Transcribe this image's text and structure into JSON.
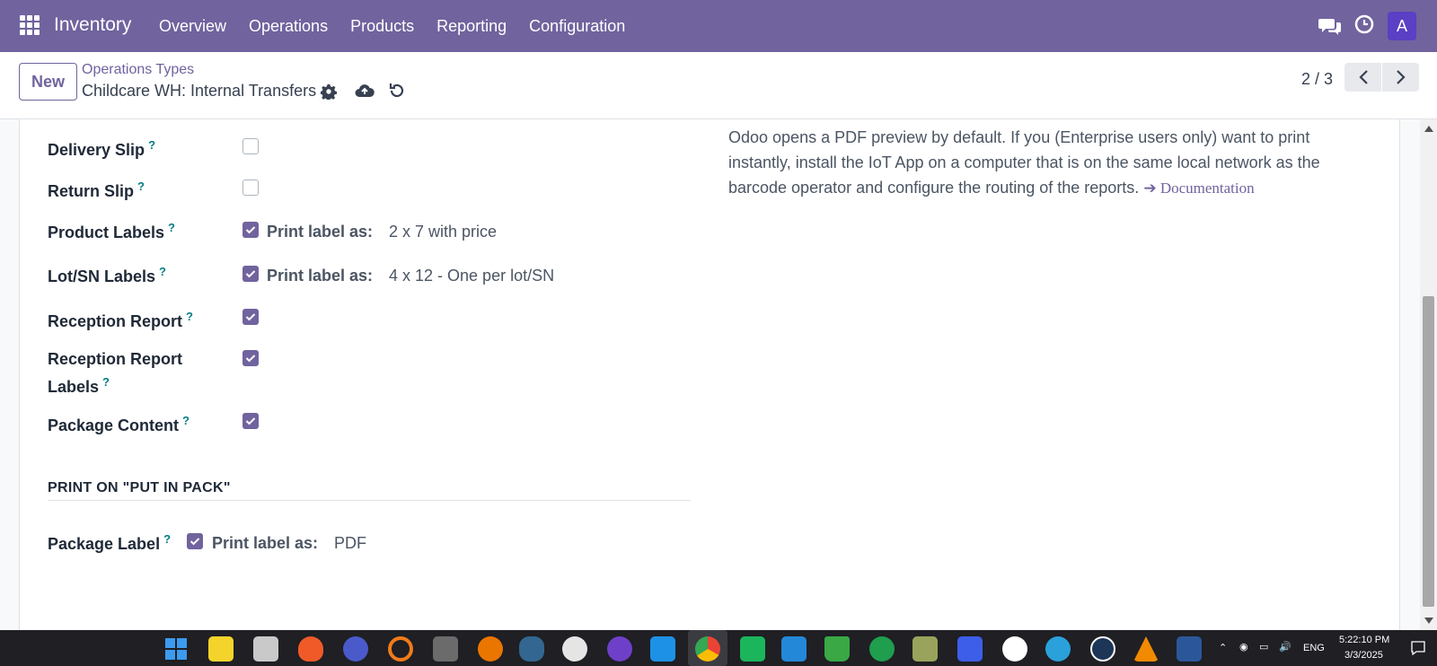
{
  "nav": {
    "app_name": "Inventory",
    "menu": [
      "Overview",
      "Operations",
      "Products",
      "Reporting",
      "Configuration"
    ],
    "avatar_letter": "A",
    "icons": [
      "apps-grid-icon",
      "chat-icon",
      "clock-icon"
    ]
  },
  "control": {
    "new_label": "New",
    "breadcrumb": "Operations Types",
    "record_title": "Childcare WH: Internal Transfers",
    "pager_value": "2 / 3"
  },
  "form": {
    "fields": [
      {
        "label": "Delivery Slip",
        "checked": false
      },
      {
        "label": "Return Slip",
        "checked": false
      },
      {
        "label": "Product Labels",
        "checked": true,
        "print_label": "Print label as:",
        "value": "2 x 7 with price"
      },
      {
        "label": "Lot/SN Labels",
        "checked": true,
        "print_label": "Print label as:",
        "value": "4 x 12 - One per lot/SN"
      },
      {
        "label": "Reception Report",
        "checked": true
      },
      {
        "label_line1": "Reception Report",
        "label_line2": "Labels",
        "checked": true
      },
      {
        "label": "Package Content",
        "checked": true
      }
    ],
    "help_mark": "?",
    "section_title": "PRINT ON \"PUT IN PACK\"",
    "package_label": {
      "label": "Package Label",
      "checked": true,
      "print_label": "Print label as:",
      "value": "PDF"
    },
    "help_text": "Odoo opens a PDF preview by default. If you (Enterprise users only) want to print instantly, install the IoT App on a computer that is on the same local network as the barcode operator and configure the routing of the reports.",
    "doc_link": "Documentation"
  },
  "taskbar": {
    "language": "ENG",
    "time": "5:22:10 PM",
    "date": "3/3/2025"
  },
  "colors": {
    "brand": "#71639e",
    "avatar": "#5b3fc4",
    "help_mark": "#017e84"
  }
}
